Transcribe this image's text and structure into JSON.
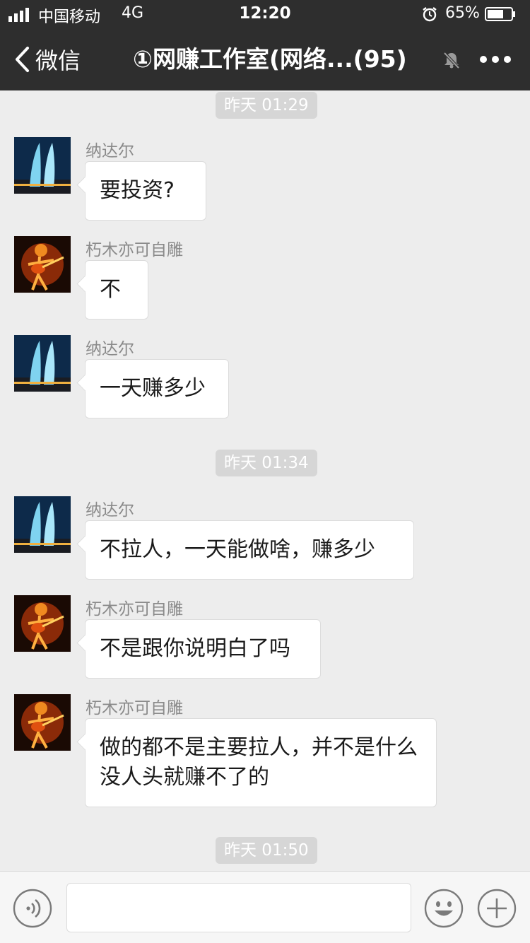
{
  "status_bar": {
    "carrier": "中国移动",
    "network": "4G",
    "time": "12:20",
    "battery": "65%"
  },
  "nav": {
    "back_label": "微信",
    "title": "①网赚工作室(网络...(95)"
  },
  "chat": {
    "timestamps": [
      "昨天 01:29",
      "昨天 01:34",
      "昨天 01:50"
    ],
    "messages": [
      {
        "sender": "纳达尔",
        "text": "要投资?"
      },
      {
        "sender": "朽木亦可自雕",
        "text": "不"
      },
      {
        "sender": "纳达尔",
        "text": "一天赚多少"
      },
      {
        "sender": "纳达尔",
        "text": "不拉人，一天能做啥，赚多少"
      },
      {
        "sender": "朽木亦可自雕",
        "text": "不是跟你说明白了吗"
      },
      {
        "sender": "朽木亦可自雕",
        "text": "做的都不是主要拉人，并不是什么没人头就赚不了的"
      }
    ]
  },
  "input": {
    "value": "",
    "placeholder": ""
  },
  "colors": {
    "header_bg": "#2e2e2e",
    "chat_bg": "#ededed",
    "bubble_bg": "#ffffff",
    "timestamp_bg": "#d6d6d6"
  },
  "icons": {
    "back": "chevron-left-icon",
    "mute": "bell-muted-icon",
    "more": "more-dots-icon",
    "voice": "voice-icon",
    "emoji": "emoji-icon",
    "plus": "plus-icon"
  }
}
